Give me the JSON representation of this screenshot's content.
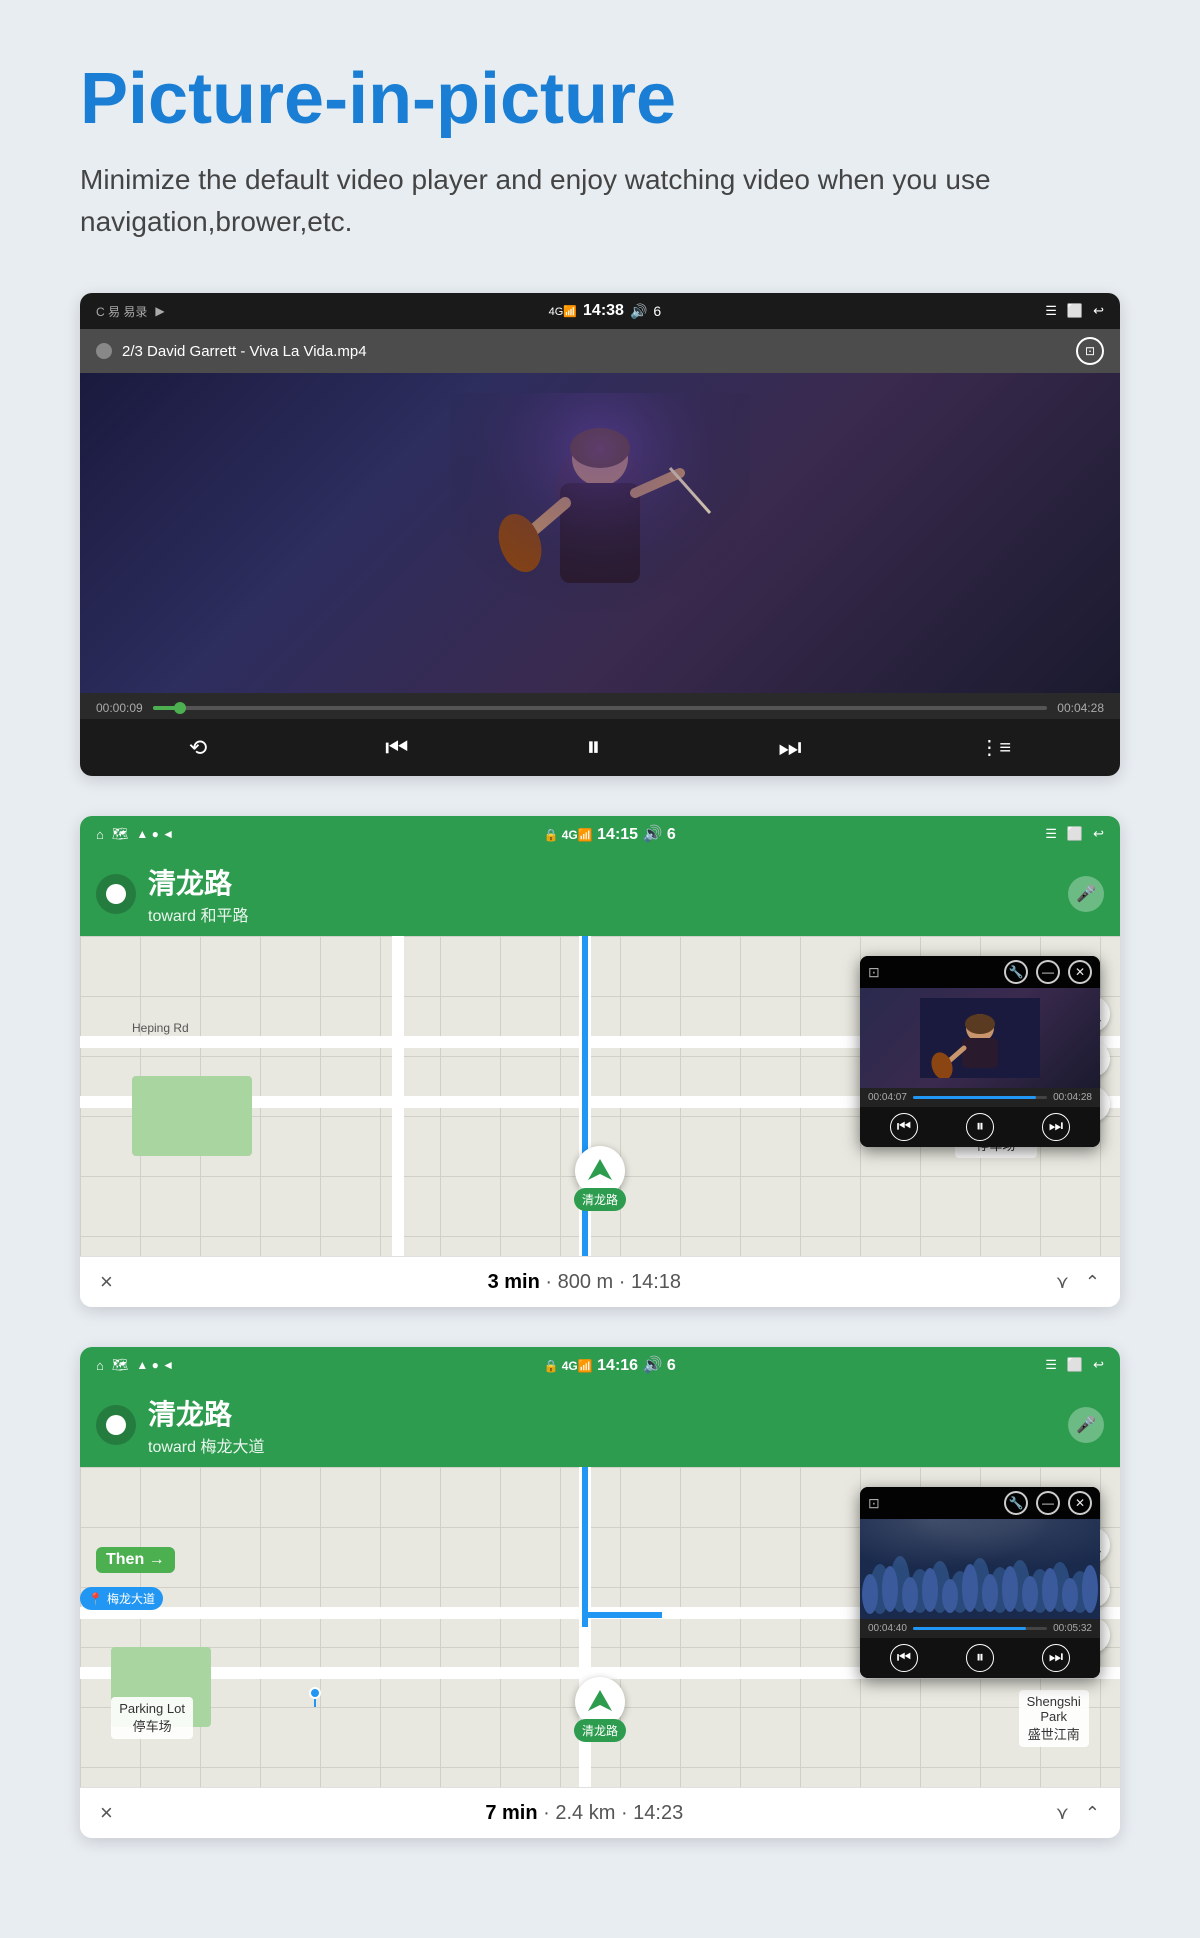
{
  "page": {
    "title": "Picture-in-picture",
    "subtitle": "Minimize the default video player and enjoy watching video when you use navigation,brower,etc."
  },
  "video_screenshot": {
    "status_bar": {
      "left": "C 易 易录",
      "signal": "4G",
      "time": "14:38",
      "volume": "🔊",
      "vol_num": "6"
    },
    "header": {
      "track_info": "2/3 David Garrett - Viva La Vida.mp4"
    },
    "progress": {
      "current": "00:00:09",
      "total": "00:04:28",
      "percent": 3
    },
    "controls": {
      "repeat": "⟲",
      "prev": "⏮",
      "pause": "⏸",
      "next": "⏭",
      "playlist": "≡"
    }
  },
  "nav_screenshot_1": {
    "status_bar": {
      "time": "14:15",
      "signal": "4G",
      "vol_num": "6"
    },
    "nav_header": {
      "street": "清龙路",
      "toward": "toward 和平路"
    },
    "map": {
      "road_label_1": "Heping Rd",
      "road_label_2": "Heping Rd",
      "parking_label": "Parking Lot\n停车场",
      "location_label": "清龙路"
    },
    "pip": {
      "time_current": "00:04:07",
      "time_total": "00:04:28",
      "percent": 92
    },
    "bottom_bar": {
      "close": "×",
      "info": "3 min · 800 m · 14:18"
    }
  },
  "nav_screenshot_2": {
    "status_bar": {
      "time": "14:16",
      "signal": "4G",
      "vol_num": "6"
    },
    "nav_header": {
      "street": "清龙路",
      "toward": "toward 梅龙大道"
    },
    "map": {
      "road_label": "梅龙大道",
      "parking_label": "Parking Lot\n停车场",
      "location_label": "清龙路",
      "park_label": "Shengshi\nPark\n盛世江南",
      "then_label": "Then →"
    },
    "pip": {
      "time_current": "00:04:40",
      "time_total": "00:05:32",
      "percent": 84
    },
    "bottom_bar": {
      "close": "×",
      "info": "7 min · 2.4 km · 14:23"
    }
  },
  "icons": {
    "home": "⌂",
    "maps": "🗺",
    "menu": "☰",
    "back": "↩",
    "window": "⬜",
    "lock": "🔒",
    "mic": "🎤",
    "search": "🔍",
    "speaker": "🔊",
    "compass": "🧭",
    "location": "📍",
    "pip_icon": "⊡",
    "minimize": "—",
    "close": "✕",
    "wrench": "🔧"
  },
  "colors": {
    "accent_blue": "#1a7fd4",
    "nav_green": "#2d9c4f",
    "map_bg": "#e8e8e0",
    "pip_blue": "#2196F3"
  }
}
